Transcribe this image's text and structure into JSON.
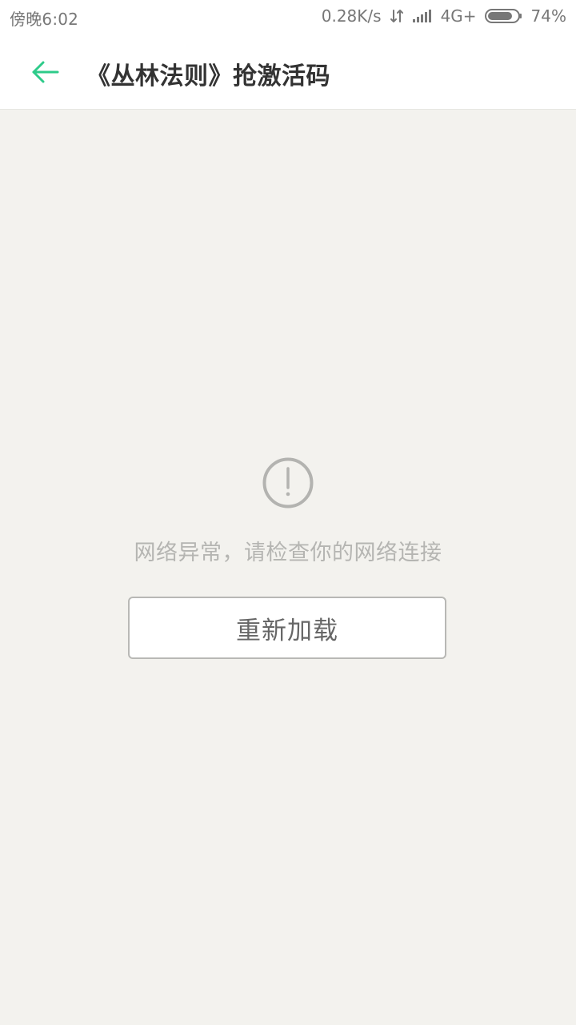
{
  "status_bar": {
    "time": "傍晚6:02",
    "network_speed": "0.28K/s",
    "network_type": "4G+",
    "battery": "74%",
    "icons": {
      "data_arrows": "data-arrows-icon",
      "signal": "signal-icon",
      "battery": "battery-icon"
    }
  },
  "header": {
    "title": "《丛林法则》抢激活码",
    "back_icon": "back-arrow-icon",
    "accent_color": "#2ecb8a"
  },
  "main": {
    "error_icon": "exclamation-circle-icon",
    "error_message": "网络异常，请检查你的网络连接",
    "reload_label": "重新加载"
  }
}
